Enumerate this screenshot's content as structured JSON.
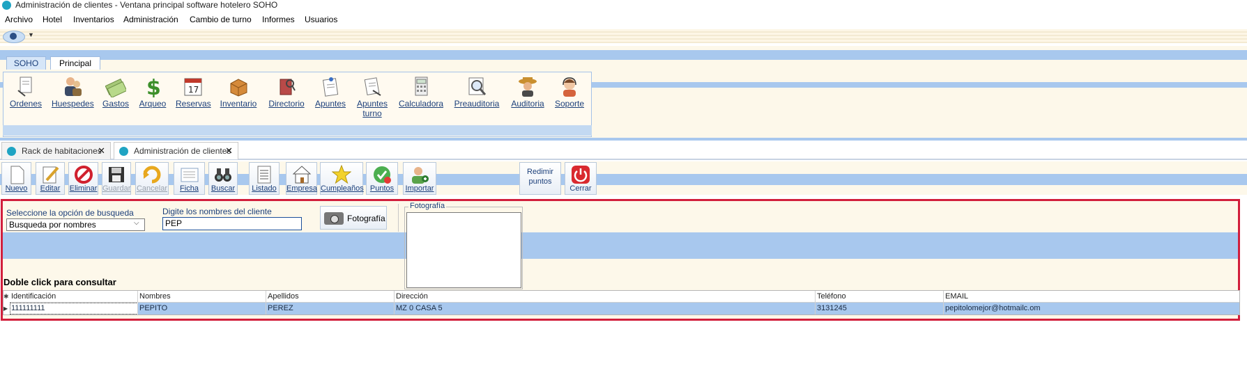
{
  "window": {
    "title": "Administración de clientes - Ventana principal software hotelero SOHO"
  },
  "menu": [
    "Archivo",
    "Hotel",
    "Inventarios",
    "Administración",
    "Cambio de turno",
    "Informes",
    "Usuarios"
  ],
  "ribbon": {
    "tabs": [
      "SOHO",
      "Principal"
    ],
    "buttons": [
      {
        "label": "Ordenes",
        "icon": "orders-document-icon"
      },
      {
        "label": "Huespedes",
        "icon": "guests-people-icon"
      },
      {
        "label": "Gastos",
        "icon": "expenses-money-icon"
      },
      {
        "label": "Arqueo",
        "icon": "cash-count-dollar-icon"
      },
      {
        "label": "Reservas",
        "icon": "calendar-reservation-icon"
      },
      {
        "label": "Inventario",
        "icon": "inventory-box-icon"
      },
      {
        "label": "Directorio",
        "icon": "directory-book-icon"
      },
      {
        "label": "Apuntes",
        "icon": "notes-pin-icon"
      },
      {
        "label": "Apuntes turno",
        "icon": "shift-notes-icon"
      },
      {
        "label": "Calculadora",
        "icon": "calculator-icon"
      },
      {
        "label": "Preauditoria",
        "icon": "preaudit-magnifier-icon"
      },
      {
        "label": "Auditoria",
        "icon": "audit-detective-icon"
      },
      {
        "label": "Soporte",
        "icon": "support-headset-icon"
      }
    ]
  },
  "doc_tabs": [
    {
      "label": "Rack de habitaciones",
      "active": false
    },
    {
      "label": "Administración de clientes",
      "active": true
    }
  ],
  "toolbar": {
    "buttons": [
      {
        "label": "Nuevo",
        "icon": "new-document-icon",
        "enabled": true
      },
      {
        "label": "Editar",
        "icon": "edit-pencil-icon",
        "enabled": true
      },
      {
        "label": "Eliminar",
        "icon": "delete-no-icon",
        "enabled": true
      },
      {
        "label": "Guardar",
        "icon": "save-floppy-icon",
        "enabled": false
      },
      {
        "label": "Cancelar",
        "icon": "cancel-undo-icon",
        "enabled": false
      },
      {
        "label": "Ficha",
        "icon": "card-form-icon",
        "enabled": true
      },
      {
        "label": "Buscar",
        "icon": "binoculars-icon",
        "enabled": true
      },
      {
        "label": "Listado",
        "icon": "list-document-icon",
        "enabled": true
      },
      {
        "label": "Empresa",
        "icon": "company-house-icon",
        "enabled": true
      },
      {
        "label": "Cumpleaños",
        "icon": "birthday-star-icon",
        "enabled": true
      },
      {
        "label": "Puntos",
        "icon": "points-icon",
        "enabled": true
      },
      {
        "label": "Importar",
        "icon": "import-user-icon",
        "enabled": true
      }
    ],
    "redeem_label": "Redimir puntos",
    "close_label": "Cerrar"
  },
  "search": {
    "option_label": "Seleccione la opción de busqueda",
    "option_value": "Busqueda por nombres",
    "names_label": "Digite los nombres del cliente",
    "names_value": "PEP",
    "photo_button": "Fotografía",
    "photo_group_title": "Fotografía",
    "hint": "Doble click para consultar"
  },
  "grid": {
    "columns": [
      "Identificación",
      "Nombres",
      "Apellidos",
      "Dirección",
      "Teléfono",
      "EMAIL"
    ],
    "rows": [
      [
        "111111111",
        "PEPITO",
        "PEREZ",
        "MZ 0 CASA 5",
        "3131245",
        "pepitolomejor@hotmailc.om"
      ]
    ]
  },
  "colors": {
    "accent_blue": "#a8c8ee",
    "highlight_border": "#d21f3c",
    "app_icon": "#1fa4c3"
  }
}
